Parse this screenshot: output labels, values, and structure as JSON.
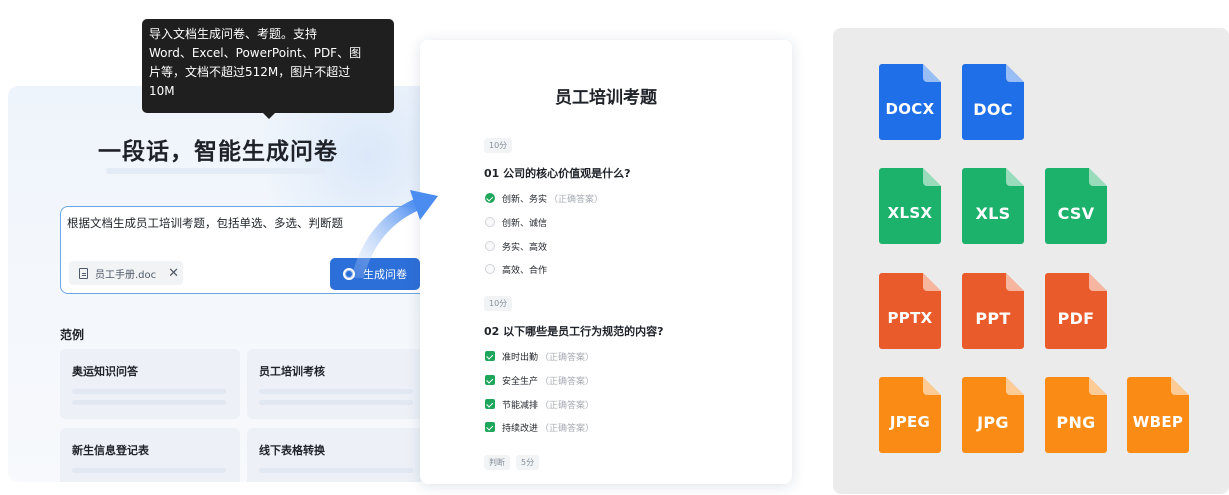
{
  "tooltip": {
    "line1": "导入文档生成问卷、考题。支持",
    "line2": "Word、Excel、PowerPoint、PDF、图",
    "line3": "片等，文档不超过512M，图片不超过",
    "line4": "10M"
  },
  "hero": {
    "title": "一段话，智能生成问卷"
  },
  "prompt": {
    "text": "根据文档生成员工培训考题，包括单选、多选、判断题",
    "attachment": "员工手册.doc",
    "close_glyph": "✕",
    "generate_label": "生成问卷"
  },
  "examples": {
    "label": "范例",
    "items": [
      "奥运知识问答",
      "员工培训考核",
      "新生信息登记表",
      "线下表格转换"
    ]
  },
  "survey": {
    "title": "员工培训考题",
    "q1": {
      "score": "10分",
      "text": "01 公司的核心价值观是什么?",
      "options": [
        {
          "text": "创新、务实",
          "hint": "（正确答案）",
          "state": "checked"
        },
        {
          "text": "创新、诚信",
          "hint": "",
          "state": "empty"
        },
        {
          "text": "务实、高效",
          "hint": "",
          "state": "empty"
        },
        {
          "text": "高效、合作",
          "hint": "",
          "state": "empty"
        }
      ]
    },
    "q2": {
      "score": "10分",
      "text": "02 以下哪些是员工行为规范的内容?",
      "options": [
        {
          "text": "准时出勤",
          "hint": "（正确答案）",
          "state": "checked"
        },
        {
          "text": "安全生产",
          "hint": "（正确答案）",
          "state": "checked"
        },
        {
          "text": "节能减排",
          "hint": "（正确答案）",
          "state": "checked"
        },
        {
          "text": "持续改进",
          "hint": "（正确答案）",
          "state": "checked"
        }
      ]
    },
    "q3": {
      "type_tag": "判断",
      "score": "5分"
    }
  },
  "formats": {
    "colors": {
      "word": "#1e6fe8",
      "excel": "#1cb26b",
      "ppt": "#ea5b2c",
      "image": "#fa8c16"
    },
    "items": [
      "DOCX",
      "DOC",
      "XLSX",
      "XLS",
      "CSV",
      "PPTX",
      "PPT",
      "PDF",
      "JPEG",
      "JPG",
      "PNG",
      "WBEP"
    ]
  }
}
